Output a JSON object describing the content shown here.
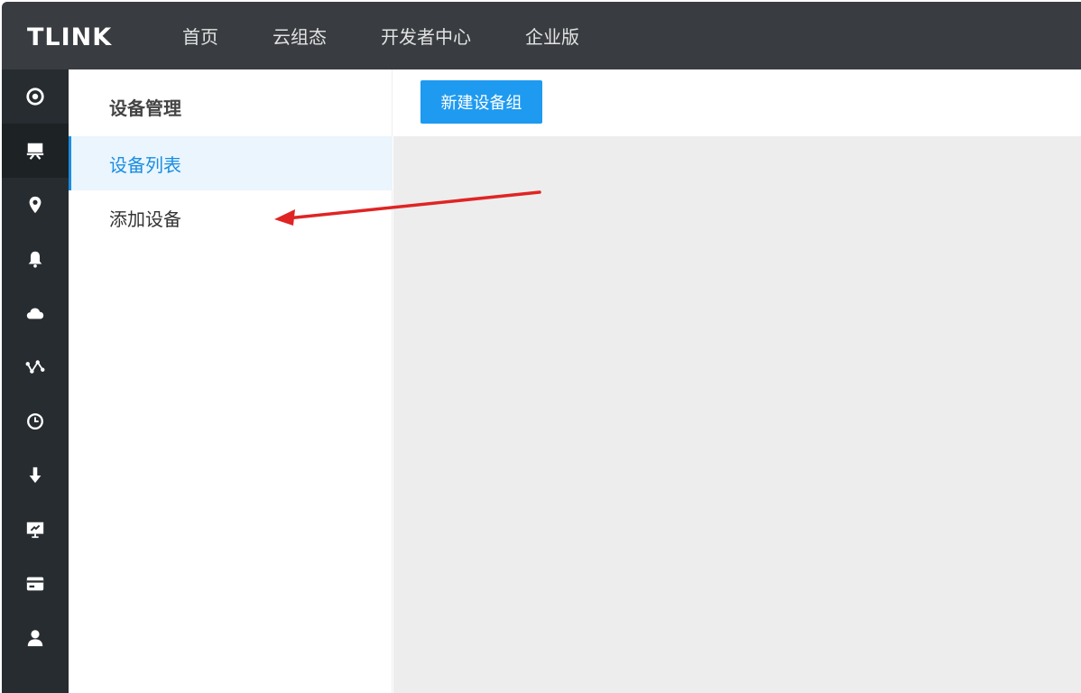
{
  "header": {
    "logo": "TLINK",
    "nav": [
      "首页",
      "云组态",
      "开发者中心",
      "企业版"
    ]
  },
  "iconbar": {
    "items": [
      {
        "icon": "target-icon"
      },
      {
        "icon": "device-icon",
        "active": true
      },
      {
        "icon": "location-pin-icon"
      },
      {
        "icon": "bell-icon"
      },
      {
        "icon": "cloud-icon"
      },
      {
        "icon": "network-icon"
      },
      {
        "icon": "clock-icon"
      },
      {
        "icon": "download-icon"
      },
      {
        "icon": "presentation-icon"
      },
      {
        "icon": "card-icon"
      },
      {
        "icon": "user-icon"
      }
    ]
  },
  "sidebar": {
    "title": "设备管理",
    "items": [
      {
        "label": "设备列表",
        "active": true
      },
      {
        "label": "添加设备",
        "active": false
      }
    ]
  },
  "toolbar": {
    "new_group_label": "新建设备组"
  },
  "colors": {
    "topbar": "#393d41",
    "iconbar": "#262c30",
    "accent": "#1e9af0",
    "active_text": "#1b8de2",
    "annotation_arrow": "#e02424"
  }
}
